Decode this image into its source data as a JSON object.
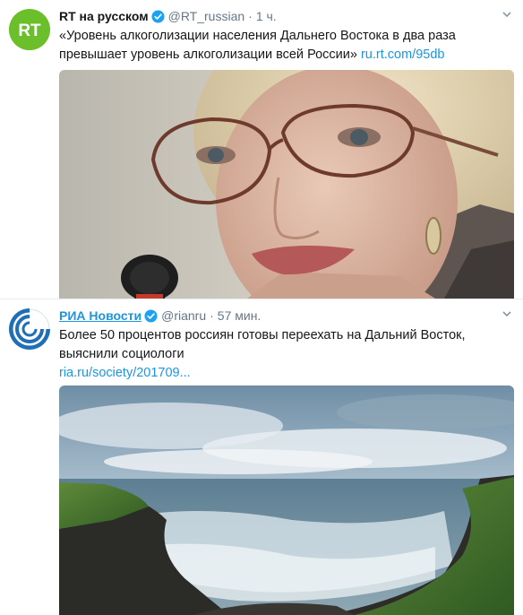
{
  "tweets": [
    {
      "author_name": "RT на русском",
      "handle": "@RT_russian",
      "separator": "·",
      "time": "1 ч.",
      "avatar_text": "RT",
      "text": "«Уровень алкоголизации населения Дальнего Востока в два раза превышает уровень алкоголизации всей России»",
      "link": "ru.rt.com/95db",
      "image": "photo-woman-glasses-microphone",
      "verified_icon": "verified-badge-icon"
    },
    {
      "author_name": "РИА Новости",
      "handle": "@rianru",
      "separator": "·",
      "time": "57 мин.",
      "text": "Более 50 процентов россиян готовы переехать на Дальний Восток, выяснили социологи",
      "link": "ria.ru/society/201709...",
      "image": "photo-sea-bay-coast",
      "verified_icon": "verified-badge-icon"
    }
  ],
  "colors": {
    "link": "#1b95e0",
    "muted": "#657786",
    "rt_green": "#6bbf2a",
    "ria_blue": "#1e6fb5"
  }
}
